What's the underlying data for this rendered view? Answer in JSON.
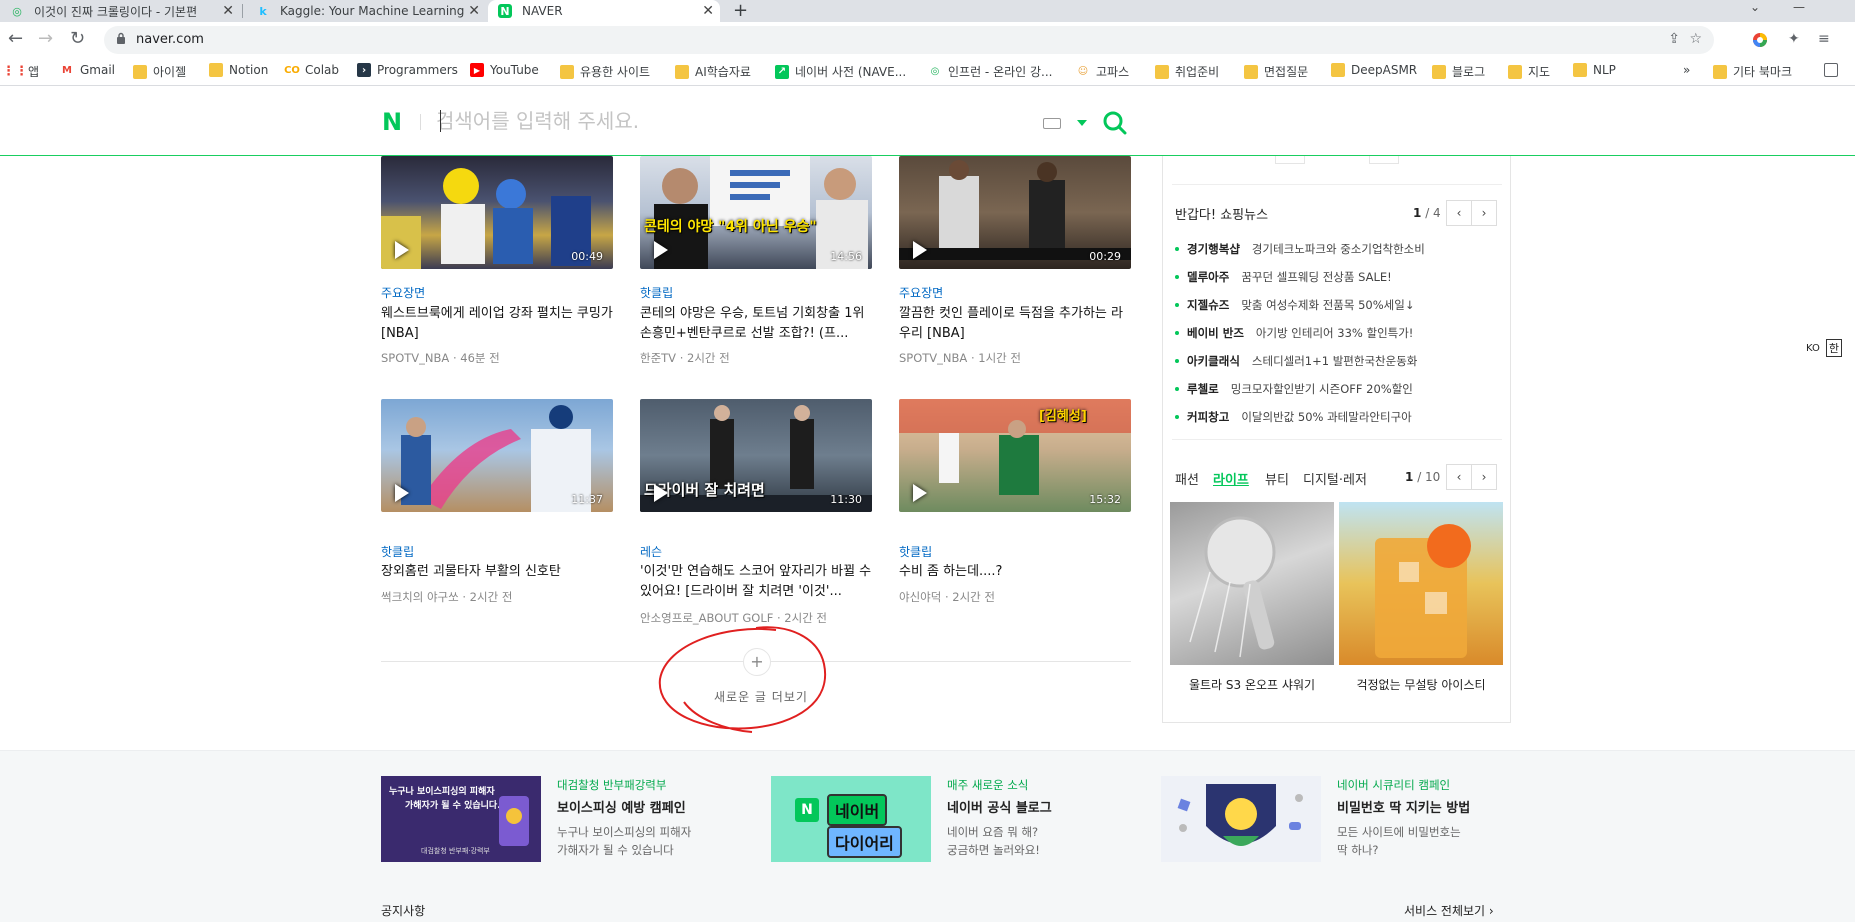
{
  "browser": {
    "tabs": [
      {
        "title": "이것이 진짜 크롤링이다 - 기본편",
        "fav_color": "#1fb25a",
        "fav_glyph": "◎"
      },
      {
        "title": "Kaggle: Your Machine Learning",
        "fav_color": "#20beff",
        "fav_glyph": "k"
      },
      {
        "title": "NAVER",
        "fav_color": "#03c75a",
        "fav_glyph": "N"
      }
    ],
    "url": "naver.com",
    "bookmarks": [
      "앱",
      "Gmail",
      "아이젤",
      "Notion",
      "Colab",
      "Programmers",
      "YouTube",
      "유용한 사이트",
      "AI학습자료",
      "네이버 사전 (NAVE...",
      "인프런 - 온라인 강...",
      "고파스",
      "취업준비",
      "면접질문",
      "DeepASMR",
      "블로그",
      "지도",
      "NLP"
    ],
    "bookmarks_more": "»",
    "other_bookmarks": "기타 북마크"
  },
  "naver": {
    "logo": "N",
    "search_placeholder": "검색어를 입력해 주세요.",
    "brand_color": "#03c75a"
  },
  "videos": [
    {
      "category": "주요장면",
      "title": "웨스트브룩에게 레이업 강좌 펼치는 쿠밍가 [NBA]",
      "meta": "SPOTV_NBA · 46분 전",
      "duration": "00:49",
      "overlay": ""
    },
    {
      "category": "핫클립",
      "title": "콘테의 야망은 우승, 토트넘 기회창출 1위 손흥민+벤탄쿠르로 선발 조합?! (프...",
      "meta": "한준TV · 2시간 전",
      "duration": "14:56",
      "overlay": "콘테의 야망 \"4위 아닌 우승\""
    },
    {
      "category": "주요장면",
      "title": "깔끔한 컷인 플레이로 득점을 추가하는 라우리 [NBA]",
      "meta": "SPOTV_NBA · 1시간 전",
      "duration": "00:29",
      "overlay": ""
    },
    {
      "category": "핫클립",
      "title": "장외홈런 괴물타자 부활의 신호탄",
      "meta": "썩크치의 야구쏘 · 2시간 전",
      "duration": "11:37",
      "overlay": ""
    },
    {
      "category": "레슨",
      "title": "'이것'만 연습해도 스코어 앞자리가 바뀔 수 있어요! [드라이버 잘 치려면 '이것'...",
      "meta": "안소영프로_ABOUT GOLF · 2시간 전",
      "duration": "11:30",
      "overlay": "드라이버 잘 치려면"
    },
    {
      "category": "핫클립",
      "title": "수비 좀 하는데....?",
      "meta": "야신야덕 · 2시간 전",
      "duration": "15:32",
      "overlay": "[김혜성]"
    }
  ],
  "more": {
    "plus": "+",
    "label": "새로운 글 더보기"
  },
  "shopping": {
    "title": "반갑다! 쇼핑뉴스",
    "page_current": "1",
    "page_total": "/ 4",
    "items": [
      {
        "brand": "경기행복샵",
        "desc": "경기테크노파크와 중소기업착한소비"
      },
      {
        "brand": "델루아주",
        "desc": "꿈꾸던 셀프웨딩 전상품 SALE!"
      },
      {
        "brand": "지젤슈즈",
        "desc": "맞춤 여성수제화 전품목 50%세일↓"
      },
      {
        "brand": "베이비 반즈",
        "desc": "아기방 인테리어 33% 할인특가!"
      },
      {
        "brand": "아키클래식",
        "desc": "스테디셀러1+1 발편한국찬운동화"
      },
      {
        "brand": "루첼로",
        "desc": "밍크모자할인받기 시즌OFF 20%할인"
      },
      {
        "brand": "커피창고",
        "desc": "이달의반값 50% 과테말라안티구아"
      }
    ],
    "cat_tabs": [
      "패션",
      "라이프",
      "뷰티",
      "디지털·레저"
    ],
    "active_tab": "라이프",
    "cat_page_current": "1",
    "cat_page_total": "/ 10",
    "products": [
      "울트라 S3 온오프 샤워기",
      "걱정없는 무설탕 아이스티"
    ]
  },
  "ime": {
    "lang": "KO",
    "mode": "한"
  },
  "promos": [
    {
      "tag": "대검찰청 반부패강력부",
      "title": "보이스피싱 예방 캠페인",
      "desc": "누구나 보이스피싱의 피해자\n가해자가 될 수 있습니다",
      "img_text1": "누구나 보이스피싱의 피해자",
      "img_text2": "가해자가 될 수 있습니다.",
      "img_text3": "대검찰청 반부패·강력부"
    },
    {
      "tag": "매주 새로운 소식",
      "title": "네이버 공식 블로그",
      "desc": "네이버 요즘 뭐 해?\n궁금하면 놀러와요!",
      "img_text1": "네이버",
      "img_text2": "다이어리",
      "img_text3": "N"
    },
    {
      "tag": "네이버 시큐리티 캠페인",
      "title": "비밀번호 딱 지키는 방법",
      "desc": "모든 사이트에 비밀번호는\n딱 하나?",
      "img_text1": "",
      "img_text2": "",
      "img_text3": ""
    }
  ],
  "footer": {
    "notice": "공지사항",
    "service_all": "서비스 전체보기 ›"
  }
}
